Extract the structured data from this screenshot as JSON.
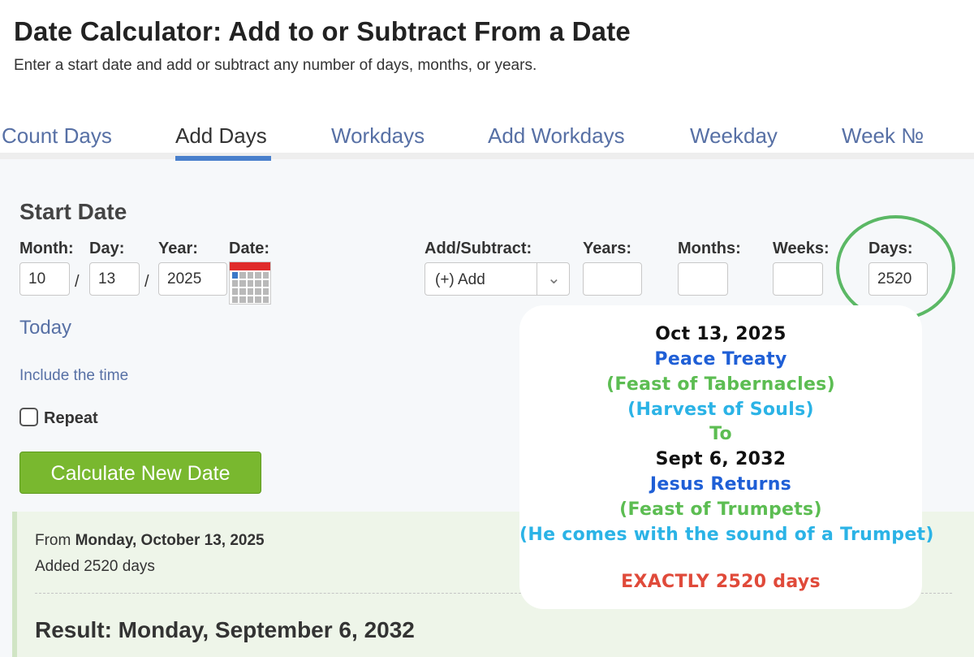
{
  "page": {
    "title": "Date Calculator: Add to or Subtract From a Date",
    "subtitle": "Enter a start date and add or subtract any number of days, months, or years."
  },
  "tabs": [
    {
      "label": "Count Days",
      "active": false
    },
    {
      "label": "Add Days",
      "active": true
    },
    {
      "label": "Workdays",
      "active": false
    },
    {
      "label": "Add Workdays",
      "active": false
    },
    {
      "label": "Weekday",
      "active": false
    },
    {
      "label": "Week №",
      "active": false
    }
  ],
  "form": {
    "section_title": "Start Date",
    "month": {
      "label": "Month:",
      "value": "10"
    },
    "day": {
      "label": "Day:",
      "value": "13"
    },
    "year": {
      "label": "Year:",
      "value": "2025"
    },
    "date_label": "Date:",
    "calendar_icon": "calendar-icon",
    "separator": "/",
    "add_subtract": {
      "label": "Add/Subtract:",
      "selected": "(+) Add"
    },
    "years": {
      "label": "Years:",
      "value": ""
    },
    "months": {
      "label": "Months:",
      "value": ""
    },
    "weeks": {
      "label": "Weeks:",
      "value": ""
    },
    "days": {
      "label": "Days:",
      "value": "2520"
    },
    "today_link": "Today",
    "include_time_link": "Include the time",
    "repeat_label": "Repeat",
    "repeat_checked": false,
    "calculate_button": "Calculate New Date"
  },
  "result": {
    "from_prefix": "From",
    "from_date": "Monday, October 13, 2025",
    "added": "Added 2520 days",
    "result": "Result: Monday, September 6, 2032"
  },
  "annotation": {
    "circle_color": "#5bb865",
    "lines": [
      {
        "text": "Oct 13, 2025",
        "color": "#111111"
      },
      {
        "text": "Peace Treaty",
        "color": "#1f5fd6"
      },
      {
        "text": "(Feast of Tabernacles)",
        "color": "#5cbd52"
      },
      {
        "text": "(Harvest of Souls)",
        "color": "#2bb3e6"
      },
      {
        "text": "To",
        "color": "#5cbd52"
      },
      {
        "text": "Sept 6, 2032",
        "color": "#111111"
      },
      {
        "text": "Jesus Returns",
        "color": "#1f5fd6"
      },
      {
        "text": "(Feast of Trumpets)",
        "color": "#5cbd52"
      },
      {
        "text": "(He comes with the sound of a Trumpet)",
        "color": "#2bb3e6"
      },
      {
        "text": "EXACTLY 2520 days",
        "color": "#e04a3a"
      }
    ]
  },
  "colors": {
    "tab_link": "#5770a5",
    "tab_underline": "#4a80cc",
    "button_green": "#79b82f",
    "result_bg": "#eef5e9"
  }
}
